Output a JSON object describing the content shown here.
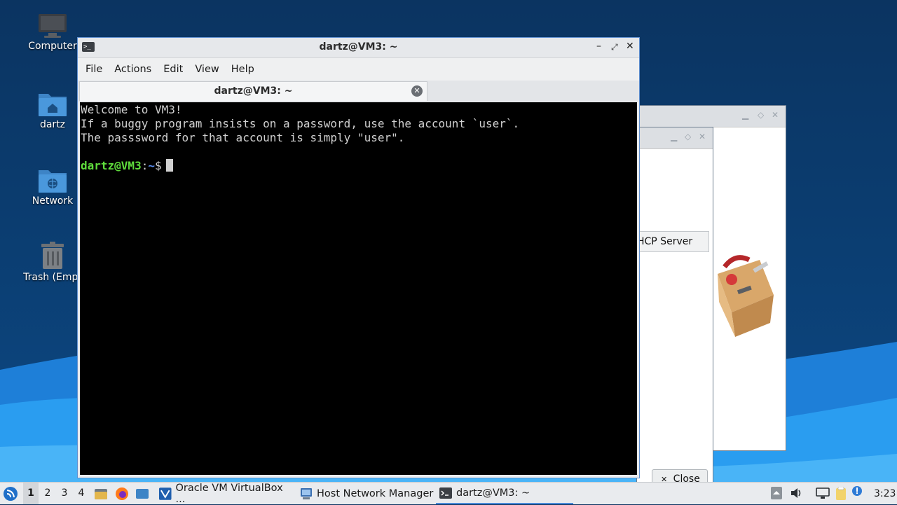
{
  "desktop": {
    "icons": [
      {
        "label": "Computer",
        "icon": "computer-icon"
      },
      {
        "label": "dartz",
        "icon": "home-folder-icon"
      },
      {
        "label": "Network",
        "icon": "network-folder-icon"
      },
      {
        "label": "Trash (Empt",
        "icon": "trash-icon"
      }
    ]
  },
  "background_windows": {
    "dhcp_tab_label": "HCP Server",
    "close_button": "Close"
  },
  "terminal": {
    "window_title": "dartz@VM3: ~",
    "menu": [
      "File",
      "Actions",
      "Edit",
      "View",
      "Help"
    ],
    "tab_title": "dartz@VM3: ~",
    "output_lines": [
      "Welcome to VM3!",
      "If a buggy program insists on a password, use the account `user`.",
      "The passsword for that account is simply \"user\"."
    ],
    "prompt": {
      "user_host": "dartz@VM3",
      "separator": ":",
      "path": "~",
      "symbol": "$"
    }
  },
  "taskbar": {
    "workspaces": [
      "1",
      "2",
      "3",
      "4"
    ],
    "active_workspace": "1",
    "tasks": [
      {
        "label": "Oracle VM VirtualBox ...",
        "icon": "virtualbox-icon"
      },
      {
        "label": "Host Network Manager",
        "icon": "network-manager-icon"
      },
      {
        "label": "dartz@VM3: ~",
        "icon": "terminal-icon",
        "active": true
      }
    ],
    "clock": "3:23"
  },
  "colors": {
    "accent": "#4a8ad8",
    "prompt_user": "#5fdc3c",
    "prompt_path": "#5b8ef0",
    "terminal_bg": "#000000",
    "terminal_fg": "#d0d0d0"
  }
}
